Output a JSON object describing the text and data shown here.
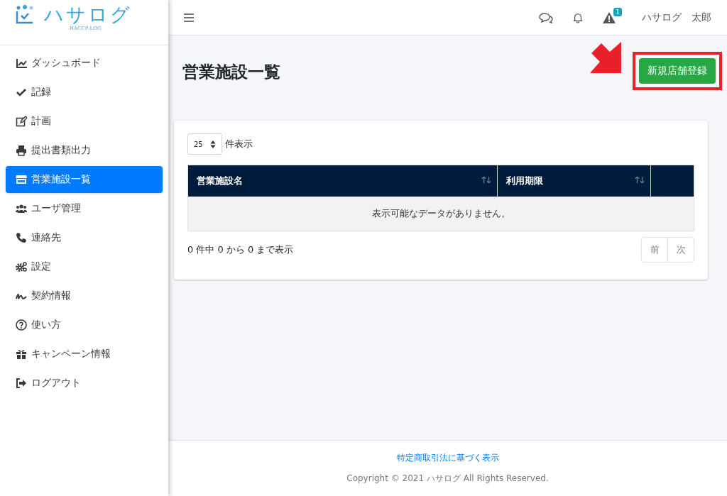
{
  "logo": {
    "title": "ハサログ",
    "subtitle": "HACCP-LOG"
  },
  "sidebar": {
    "items": [
      {
        "label": "ダッシュボード",
        "selected": false
      },
      {
        "label": "記録",
        "selected": false
      },
      {
        "label": "計画",
        "selected": false
      },
      {
        "label": "提出書類出力",
        "selected": false
      },
      {
        "label": "営業施設一覧",
        "selected": true
      },
      {
        "label": "ユーザ管理",
        "selected": false
      },
      {
        "label": "連絡先",
        "selected": false
      },
      {
        "label": "設定",
        "selected": false
      },
      {
        "label": "契約情報",
        "selected": false
      },
      {
        "label": "使い方",
        "selected": false
      },
      {
        "label": "キャンペーン情報",
        "selected": false
      },
      {
        "label": "ログアウト",
        "selected": false
      }
    ]
  },
  "header": {
    "alert_badge": "1",
    "user_name": "ハサログ　太郎"
  },
  "page": {
    "title": "営業施設一覧",
    "new_button": "新規店舗登録"
  },
  "table": {
    "page_size": "25",
    "page_size_label": "件表示",
    "columns": [
      {
        "label": "営業施設名",
        "sortable": true
      },
      {
        "label": "利用期限",
        "sortable": true
      }
    ],
    "empty_message": "表示可能なデータがありません。",
    "info": "0 件中 0 から 0 まで表示",
    "pagination": [
      {
        "label": "前",
        "disabled": true
      },
      {
        "label": "次",
        "disabled": true
      }
    ]
  },
  "footer": {
    "link": "特定商取引法に基づく表示",
    "copyright": "Copyright © 2021 ハサログ All Rights Reserved."
  }
}
